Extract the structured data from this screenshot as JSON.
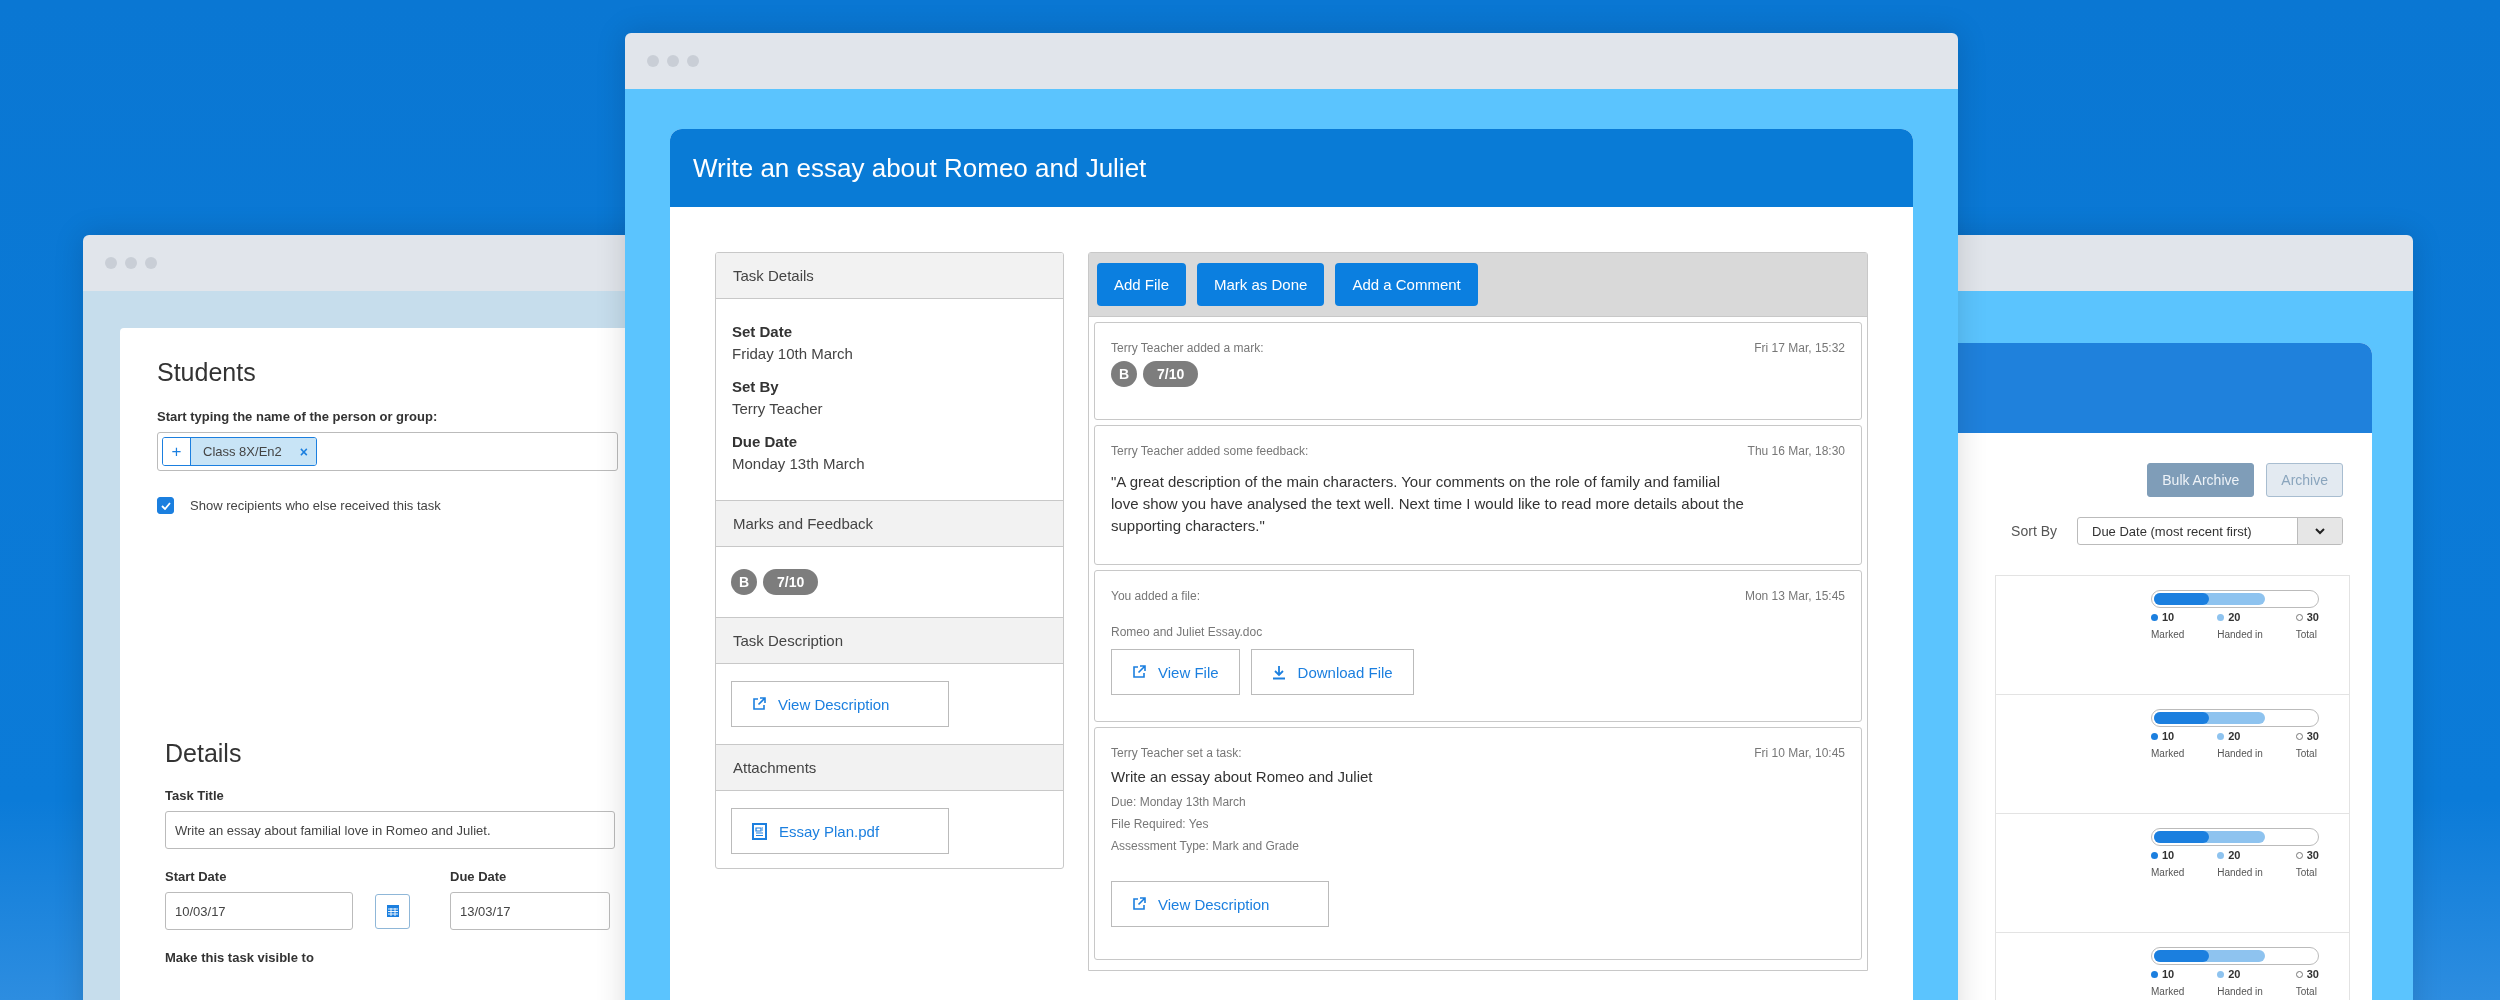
{
  "students_window": {
    "students_heading": "Students",
    "recipient_label": "Start typing the name of the person or group:",
    "add_button": "+",
    "recipient_tags": [
      {
        "label": "Class 8X/En2",
        "remove": "×"
      }
    ],
    "show_recipients": {
      "label": "Show recipients who else received this task",
      "checked": true
    },
    "details_heading": "Details",
    "task_title": {
      "label": "Task Title",
      "value": "Write an essay about familial love in Romeo and Juliet."
    },
    "start_date": {
      "label": "Start Date",
      "value": "10/03/17"
    },
    "due_date": {
      "label": "Due Date",
      "value": "13/03/17"
    },
    "visibility_label": "Make this task visible to"
  },
  "task_window": {
    "title": "Write an essay about Romeo and Juliet",
    "sections": [
      {
        "kind": "fields",
        "heading": "Task Details",
        "fields": [
          {
            "label": "Set Date",
            "value": "Friday 10th March"
          },
          {
            "label": "Set By",
            "value": "Terry Teacher"
          },
          {
            "label": "Due Date",
            "value": "Monday 13th March"
          }
        ]
      },
      {
        "kind": "marks",
        "heading": "Marks and Feedback",
        "grade": "B",
        "score": "7/10"
      },
      {
        "kind": "link",
        "heading": "Task Description",
        "button": "View Description"
      },
      {
        "kind": "attachment",
        "heading": "Attachments",
        "button": "Essay Plan.pdf"
      }
    ],
    "actions": [
      "Add File",
      "Mark as Done",
      "Add a Comment"
    ],
    "activity": [
      {
        "kind": "mark",
        "heading": "Terry Teacher added a mark:",
        "time": "Fri 17 Mar, 15:32",
        "grade": "B",
        "score": "7/10"
      },
      {
        "kind": "feedback",
        "heading": "Terry Teacher added some feedback:",
        "time": "Thu 16 Mar, 18:30",
        "text": "\"A great description of the main characters. Your comments on the role of family and familial love show you have analysed the text well. Next time I would like to read more details about the supporting characters.\""
      },
      {
        "kind": "file",
        "heading": "You added a file:",
        "time": "Mon 13 Mar, 15:45",
        "file_name": "Romeo and Juliet Essay.doc",
        "buttons": [
          {
            "kind": "view",
            "label": "View File"
          },
          {
            "kind": "download",
            "label": "Download File"
          }
        ]
      },
      {
        "kind": "task",
        "heading": "Terry Teacher set a task:",
        "time": "Fri 10 Mar, 10:45",
        "title": "Write an essay about Romeo and Juliet",
        "details": [
          "Due: Monday 13th March",
          "File Required: Yes",
          "Assessment Type: Mark and Grade"
        ],
        "buttons": [
          {
            "kind": "view",
            "label": "View Description"
          }
        ]
      }
    ]
  },
  "overview_window": {
    "buttons": [
      {
        "kind": "primary",
        "label": "Bulk Archive"
      },
      {
        "kind": "secondary",
        "label": "Archive"
      }
    ],
    "sort": {
      "label": "Sort By",
      "value": "Due Date (most recent first)"
    },
    "rows": [
      {
        "bar": [
          {
            "kind": "marked",
            "level": 0.33
          },
          {
            "kind": "handed_in",
            "level": 0.67
          }
        ],
        "stats": [
          {
            "kind": "marked",
            "count": "10",
            "label": "Marked"
          },
          {
            "kind": "handed_in",
            "count": "20",
            "label": "Handed in"
          },
          {
            "kind": "total",
            "count": "30",
            "label": "Total"
          }
        ]
      },
      {
        "bar": [
          {
            "kind": "marked",
            "level": 0.33
          },
          {
            "kind": "handed_in",
            "level": 0.67
          }
        ],
        "stats": [
          {
            "kind": "marked",
            "count": "10",
            "label": "Marked"
          },
          {
            "kind": "handed_in",
            "count": "20",
            "label": "Handed in"
          },
          {
            "kind": "total",
            "count": "30",
            "label": "Total"
          }
        ]
      },
      {
        "bar": [
          {
            "kind": "marked",
            "level": 0.33
          },
          {
            "kind": "handed_in",
            "level": 0.67
          }
        ],
        "stats": [
          {
            "kind": "marked",
            "count": "10",
            "label": "Marked"
          },
          {
            "kind": "handed_in",
            "count": "20",
            "label": "Handed in"
          },
          {
            "kind": "total",
            "count": "30",
            "label": "Total"
          }
        ]
      },
      {
        "bar": [
          {
            "kind": "marked",
            "level": 0.33
          },
          {
            "kind": "handed_in",
            "level": 0.67
          }
        ],
        "stats": [
          {
            "kind": "marked",
            "count": "10",
            "label": "Marked"
          },
          {
            "kind": "handed_in",
            "count": "20",
            "label": "Handed in"
          },
          {
            "kind": "total",
            "count": "30",
            "label": "Total"
          }
        ]
      }
    ]
  }
}
